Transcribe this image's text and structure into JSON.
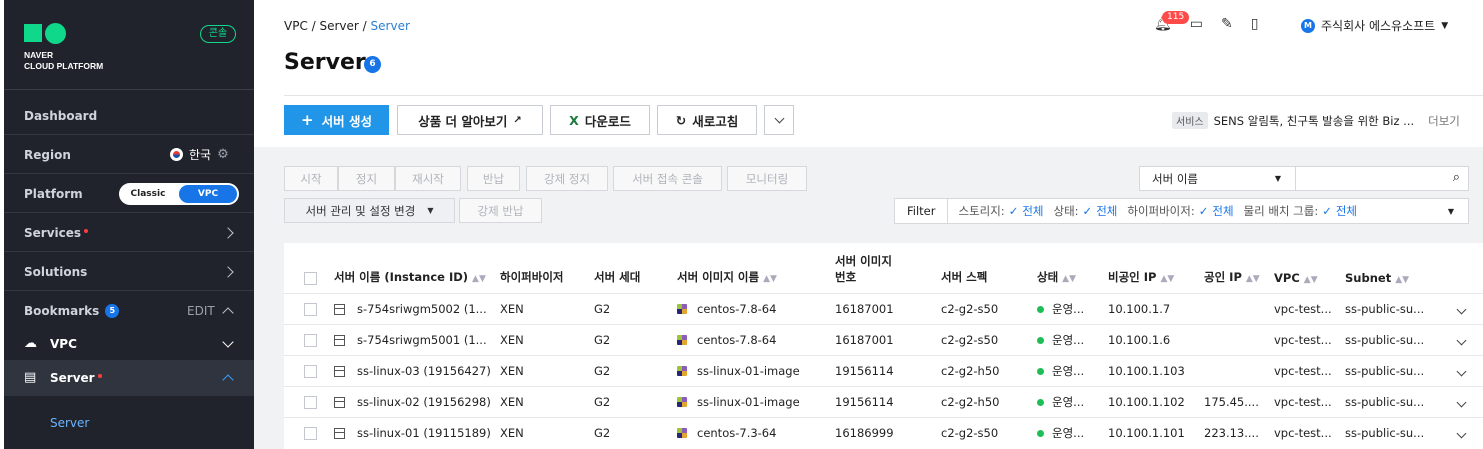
{
  "sidebar": {
    "logo_line1": "NAVER",
    "logo_line2": "CLOUD PLATFORM",
    "console_badge": "콘솔",
    "dashboard": "Dashboard",
    "region_label": "Region",
    "region_value": "한국",
    "platform_label": "Platform",
    "platform_options": [
      "Classic",
      "VPC"
    ],
    "platform_selected": "VPC",
    "services": "Services",
    "solutions": "Solutions",
    "bookmarks": "Bookmarks",
    "bookmarks_count": "5",
    "edit": "EDIT",
    "vpc": "VPC",
    "server": "Server",
    "server_sub": "Server"
  },
  "header": {
    "breadcrumb": [
      "VPC",
      "Server",
      "Server"
    ],
    "notification_count": "115",
    "user_initial": "M",
    "user_name": "주식회사 에스유소프트"
  },
  "page": {
    "title": "Server",
    "title_count": "6"
  },
  "toolbar": {
    "create": "서버 생성",
    "learn_more": "상품 더 알아보기",
    "download": "다운로드",
    "refresh": "새로고침",
    "notice_tag": "서비스",
    "notice_text": "SENS 알림톡, 친구톡 발송을 위한 Biz ...",
    "notice_more": "더보기"
  },
  "actions": {
    "row1": [
      "시작",
      "정지",
      "재시작",
      "반납",
      "강제 정지",
      "서버 접속 콘솔",
      "모니터링"
    ],
    "manage": "서버 관리 및 설정 변경",
    "force_return": "강제 반납"
  },
  "search": {
    "select_value": "서버 이름"
  },
  "filter": {
    "label": "Filter",
    "items": [
      {
        "name": "스토리지:",
        "value": "전체"
      },
      {
        "name": "상태:",
        "value": "전체"
      },
      {
        "name": "하이퍼바이저:",
        "value": "전체"
      },
      {
        "name": "물리 배치 그룹:",
        "value": "전체"
      }
    ]
  },
  "table": {
    "columns": [
      "서버 이름 (Instance ID)",
      "하이퍼바이저",
      "서버 세대",
      "서버 이미지 이름",
      "서버 이미지 번호",
      "서버 스펙",
      "상태",
      "비공인 IP",
      "공인 IP",
      "VPC",
      "Subnet"
    ],
    "rows": [
      {
        "name": "s-754sriwgm5002 (1...",
        "hv": "XEN",
        "gen": "G2",
        "image": "centos-7.8-64",
        "image_no": "16187001",
        "spec": "c2-g2-s50",
        "status": "운영...",
        "private_ip": "10.100.1.7",
        "public_ip": "",
        "vpc": "vpc-test...",
        "subnet": "ss-public-su..."
      },
      {
        "name": "s-754sriwgm5001 (1...",
        "hv": "XEN",
        "gen": "G2",
        "image": "centos-7.8-64",
        "image_no": "16187001",
        "spec": "c2-g2-s50",
        "status": "운영...",
        "private_ip": "10.100.1.6",
        "public_ip": "",
        "vpc": "vpc-test...",
        "subnet": "ss-public-su..."
      },
      {
        "name": "ss-linux-03 (19156427)",
        "hv": "XEN",
        "gen": "G2",
        "image": "ss-linux-01-image",
        "image_no": "19156114",
        "spec": "c2-g2-h50",
        "status": "운영...",
        "private_ip": "10.100.1.103",
        "public_ip": "",
        "vpc": "vpc-test...",
        "subnet": "ss-public-su..."
      },
      {
        "name": "ss-linux-02 (19156298)",
        "hv": "XEN",
        "gen": "G2",
        "image": "ss-linux-01-image",
        "image_no": "19156114",
        "spec": "c2-g2-h50",
        "status": "운영...",
        "private_ip": "10.100.1.102",
        "public_ip": "175.45....",
        "vpc": "vpc-test...",
        "subnet": "ss-public-su..."
      },
      {
        "name": "ss-linux-01 (19115189)",
        "hv": "XEN",
        "gen": "G2",
        "image": "centos-7.3-64",
        "image_no": "16186999",
        "spec": "c2-g2-s50",
        "status": "운영...",
        "private_ip": "10.100.1.101",
        "public_ip": "223.13....",
        "vpc": "vpc-test...",
        "subnet": "ss-public-su..."
      }
    ]
  }
}
